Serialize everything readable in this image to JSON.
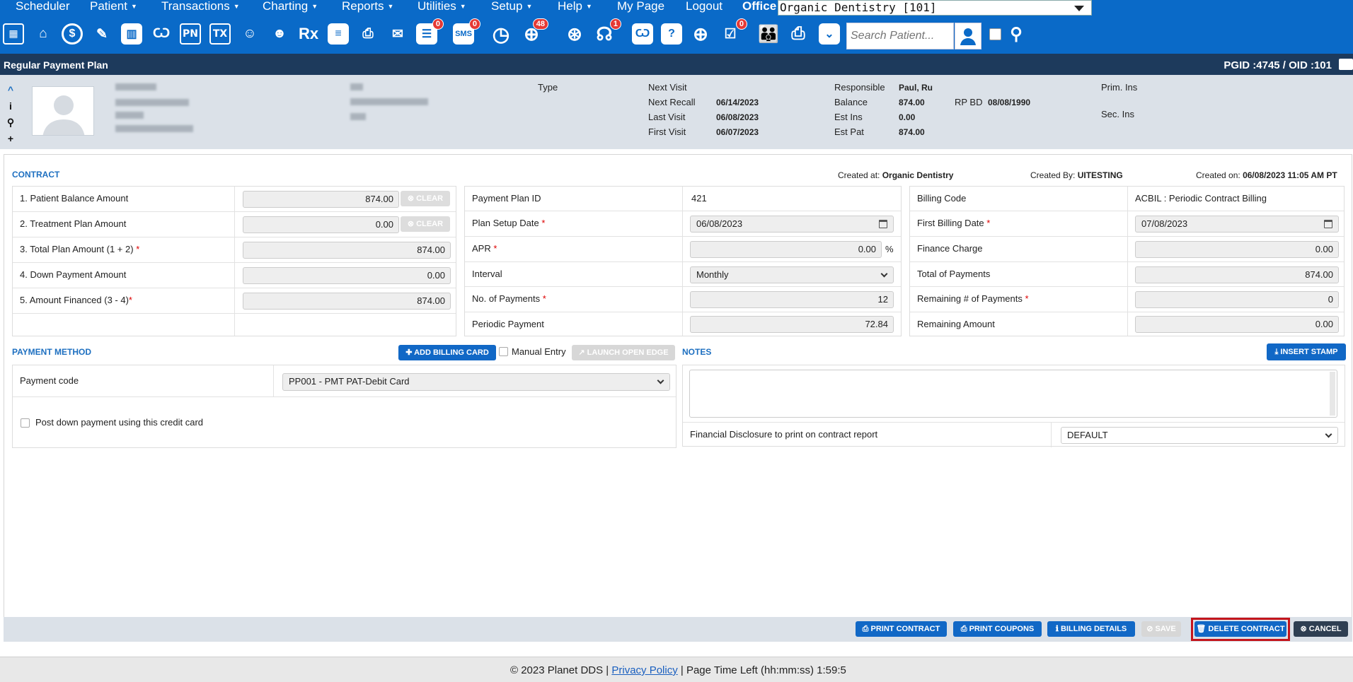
{
  "menu": {
    "items": [
      {
        "label": "Scheduler",
        "caret": false
      },
      {
        "label": "Patient",
        "caret": true
      },
      {
        "label": "Transactions",
        "caret": true
      },
      {
        "label": "Charting",
        "caret": true
      },
      {
        "label": "Reports",
        "caret": true
      },
      {
        "label": "Utilities",
        "caret": true
      },
      {
        "label": "Setup",
        "caret": true
      },
      {
        "label": "Help",
        "caret": true
      },
      {
        "label": "My Page",
        "caret": false
      },
      {
        "label": "Logout",
        "caret": false
      }
    ],
    "office_label": "Office",
    "office_value": "Organic Dentistry [101]"
  },
  "toolbar": {
    "icons": [
      "calendar-icon",
      "home-icon",
      "dollar-icon",
      "notes-edit-icon",
      "tooth-chart-icon",
      "tooth-perio-icon",
      "pn-icon",
      "tx-icon",
      "add-patient-icon",
      "family-add-icon",
      "rx-icon",
      "message-icon",
      "print-icon",
      "email-icon",
      "chat-icon",
      "sms-icon",
      "clock-icon",
      "globe-users-icon",
      "globe-icon",
      "support-icon",
      "tooth-icon",
      "tooth-question-icon",
      "globe-click-icon",
      "checklist-icon",
      "people-icon",
      "printer-icon",
      "download-icon"
    ],
    "pn_text": "PN",
    "tx_text": "TX",
    "rx_text": "Rx",
    "sms_text": "SMS",
    "badges": {
      "chat": "0",
      "sms": "0",
      "globe_users": "48",
      "support": "1",
      "checklist": "0"
    },
    "search_placeholder": "Search Patient..."
  },
  "title_bar": {
    "title": "Regular Payment Plan",
    "ids": "PGID :4745  /  OID :101"
  },
  "patient": {
    "side_icons": [
      "^",
      "i",
      "⚲",
      "+"
    ],
    "type_label": "Type",
    "next_visit_label": "Next Visit",
    "next_recall_label": "Next Recall",
    "next_recall": "06/14/2023",
    "last_visit_label": "Last Visit",
    "last_visit": "06/08/2023",
    "first_visit_label": "First Visit",
    "first_visit": "06/07/2023",
    "responsible_label": "Responsible",
    "responsible": "Paul, Ru",
    "balance_label": "Balance",
    "balance": "874.00",
    "rp_bd_label": "RP BD",
    "rp_bd": "08/08/1990",
    "est_ins_label": "Est Ins",
    "est_ins": "0.00",
    "est_pat_label": "Est Pat",
    "est_pat": "874.00",
    "prim_ins_label": "Prim. Ins",
    "sec_ins_label": "Sec. Ins"
  },
  "contract": {
    "section_title": "CONTRACT",
    "created_at_label": "Created at:",
    "created_at": "Organic Dentistry",
    "created_by_label": "Created By:",
    "created_by": "UITESTING",
    "created_on_label": "Created on:",
    "created_on": "06/08/2023 11:05 AM PT",
    "clear_label": "⊗ CLEAR",
    "left_rows": [
      {
        "label": "1.  Patient Balance Amount",
        "req": "",
        "value": "874.00"
      },
      {
        "label": "2. Treatment Plan Amount",
        "req": "",
        "value": "0.00"
      },
      {
        "label": "3. Total Plan Amount (1 + 2)",
        "req": "*",
        "value": "874.00"
      },
      {
        "label": "4. Down Payment Amount",
        "req": "",
        "value": "0.00"
      },
      {
        "label": "5. Amount Financed (3 - 4)",
        "req": "*",
        "value": "874.00"
      }
    ],
    "mid": {
      "plan_id_label": "Payment Plan ID",
      "plan_id": "421",
      "setup_date_label": "Plan Setup Date",
      "setup_date": "06/08/2023",
      "apr_label": "APR",
      "apr": "0.00",
      "apr_unit": "%",
      "interval_label": "Interval",
      "interval": "Monthly",
      "num_payments_label": "No. of Payments",
      "num_payments": "12",
      "periodic_label": "Periodic Payment",
      "periodic": "72.84"
    },
    "right": {
      "billing_code_label": "Billing Code",
      "billing_code": "ACBIL : Periodic Contract Billing",
      "first_billing_label": "First Billing Date",
      "first_billing": "07/08/2023",
      "finance_charge_label": "Finance Charge",
      "finance_charge": "0.00",
      "total_payments_label": "Total of Payments",
      "total_payments": "874.00",
      "remaining_num_label": "Remaining # of Payments",
      "remaining_num": "0",
      "remaining_amount_label": "Remaining Amount",
      "remaining_amount": "0.00"
    },
    "req_mark": "*"
  },
  "payment_method": {
    "section_title": "PAYMENT METHOD",
    "add_card_label": "✚ ADD BILLING CARD",
    "manual_entry_label": "Manual Entry",
    "launch_edge_label": "↗ LAUNCH OPEN EDGE",
    "payment_code_label": "Payment code",
    "payment_code": "PP001 - PMT PAT-Debit Card",
    "post_down_label": "Post down payment using this credit card"
  },
  "notes": {
    "section_title": "NOTES",
    "insert_stamp_label": "⤓ INSERT STAMP",
    "disclosure_label": "Financial Disclosure to print on contract report",
    "disclosure_value": "DEFAULT"
  },
  "actions": {
    "print_contract": "⎙ PRINT CONTRACT",
    "print_coupons": "⎙ PRINT COUPONS",
    "billing_details": "ℹ BILLING DETAILS",
    "save": "⊘ SAVE",
    "delete_contract": "🗑 DELETE CONTRACT",
    "cancel": "⊗ CANCEL"
  },
  "footer": {
    "copyright": "© 2023 Planet DDS | ",
    "privacy": "Privacy Policy",
    "time_left": " |  Page Time Left (hh:mm:ss) 1:59:5"
  }
}
